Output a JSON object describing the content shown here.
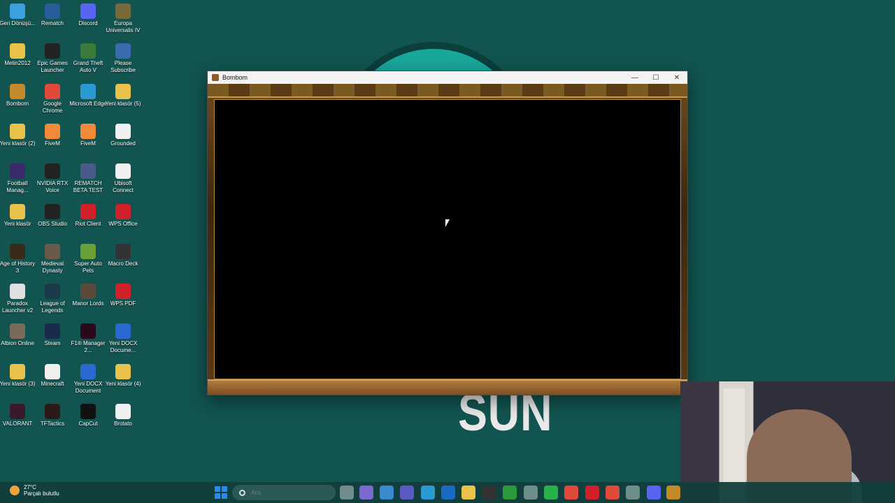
{
  "wallpaper": {
    "big_text": "SUN"
  },
  "desktop_icons": [
    {
      "label": "Geri Dönüşü...",
      "color": "#3aa0e0"
    },
    {
      "label": "Rematch",
      "color": "#2a5c9a"
    },
    {
      "label": "Discord",
      "color": "#5865f2"
    },
    {
      "label": "Europa Universalis IV",
      "color": "#7a6a3a"
    },
    {
      "label": "Metin2012",
      "color": "#e8c24a"
    },
    {
      "label": "Epic Games Launcher",
      "color": "#222222"
    },
    {
      "label": "Grand Theft Auto V",
      "color": "#3a7a3a"
    },
    {
      "label": "Please Subscribe",
      "color": "#3a6ab0"
    },
    {
      "label": "Bombom",
      "color": "#c48a2a"
    },
    {
      "label": "Google Chrome",
      "color": "#e04a3a"
    },
    {
      "label": "Microsoft Edge",
      "color": "#2a9ad0"
    },
    {
      "label": "Yeni klasör (5)",
      "color": "#e8c24a"
    },
    {
      "label": "Yeni klasör (2)",
      "color": "#e8c24a"
    },
    {
      "label": "FiveM",
      "color": "#f08a3a"
    },
    {
      "label": "FiveM",
      "color": "#f08a3a"
    },
    {
      "label": "Grounded",
      "color": "#f0f0f0"
    },
    {
      "label": "Football Manag...",
      "color": "#3a2a6a"
    },
    {
      "label": "NVIDIA RTX Voice",
      "color": "#222222"
    },
    {
      "label": "REMATCH BETA TEST",
      "color": "#4a5a8a"
    },
    {
      "label": "Ubisoft Connect",
      "color": "#f0f0f0"
    },
    {
      "label": "Yeni klasör",
      "color": "#e8c24a"
    },
    {
      "label": "OBS Studio",
      "color": "#222222"
    },
    {
      "label": "Riot Client",
      "color": "#d0202a"
    },
    {
      "label": "WPS Office",
      "color": "#d0202a"
    },
    {
      "label": "Age of History 3",
      "color": "#3a2a1a"
    },
    {
      "label": "Medieval Dynasty",
      "color": "#6a5a4a"
    },
    {
      "label": "Super Auto Pets",
      "color": "#6aa03a"
    },
    {
      "label": "Macro Deck",
      "color": "#333333"
    },
    {
      "label": "Paradox Launcher v2",
      "color": "#e0e0e0"
    },
    {
      "label": "League of Legends",
      "color": "#1a3a4a"
    },
    {
      "label": "Manor Lords",
      "color": "#5a4a3a"
    },
    {
      "label": "WPS PDF",
      "color": "#d0202a"
    },
    {
      "label": "Albion Online",
      "color": "#7a6a5a"
    },
    {
      "label": "Steam",
      "color": "#1a2a4a"
    },
    {
      "label": "F1® Manager 2...",
      "color": "#2a0a1a"
    },
    {
      "label": "Yeni DOCX Docume...",
      "color": "#2a6ad0"
    },
    {
      "label": "Yeni klasör (3)",
      "color": "#e8c24a"
    },
    {
      "label": "Minecraft",
      "color": "#f0f0f0"
    },
    {
      "label": "Yeni DOCX Document",
      "color": "#2a6ad0"
    },
    {
      "label": "Yeni klasör (4)",
      "color": "#e8c24a"
    },
    {
      "label": "VALORANT",
      "color": "#3a1a2a"
    },
    {
      "label": "TFTactics",
      "color": "#2a1a1a"
    },
    {
      "label": "CapCut",
      "color": "#111111"
    },
    {
      "label": "Brotato",
      "color": "#f0f0f0"
    }
  ],
  "window": {
    "title": "Bombom",
    "minimize": "—",
    "maximize": "☐",
    "close": "✕"
  },
  "taskbar": {
    "temperature": "27°C",
    "weather": "Parçalı bulutlu",
    "search_placeholder": "Ara"
  }
}
